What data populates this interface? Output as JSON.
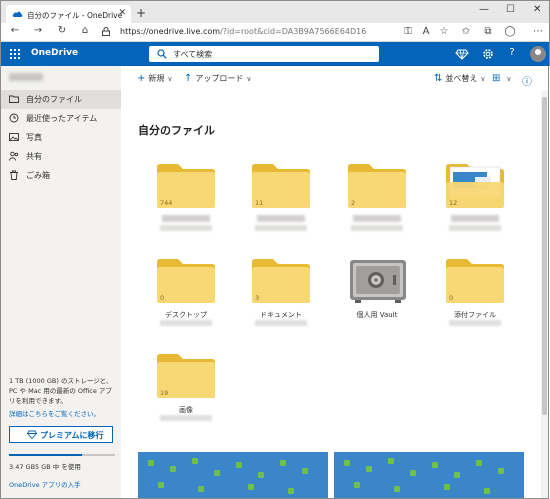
{
  "browser": {
    "tab_title": "自分のファイル - OneDrive",
    "tab_close": "✕",
    "new_tab": "+",
    "window_controls": {
      "minimize": "—",
      "maximize": "☐",
      "close": "✕"
    },
    "url_host": "https://onedrive.live.com",
    "url_query": "/?id=root&cid=DA3B9A7566E64D16",
    "nav": {
      "back": "←",
      "forward": "→",
      "refresh": "↻",
      "home": "⌂"
    }
  },
  "header": {
    "app_name": "OneDrive",
    "search_placeholder": "すべて検索",
    "help": "?"
  },
  "sidebar": {
    "items": [
      {
        "label": "自分のファイル",
        "icon": "folder-icon"
      },
      {
        "label": "最近使ったアイテム",
        "icon": "clock-icon"
      },
      {
        "label": "写真",
        "icon": "photo-icon"
      },
      {
        "label": "共有",
        "icon": "share-icon"
      },
      {
        "label": "ごみ箱",
        "icon": "trash-icon"
      }
    ],
    "storage_text": "1 TB (1000 GB) のストレージと、PC や Mac 用の最新の Office アプリを利用できます。",
    "detail_link": "詳細はこちらをご覧ください。",
    "premium_button": "プレミアムに移行",
    "usage_text": "3.47 GB5 GB 中 を使用",
    "get_app_link": "OneDrive アプリの入手",
    "storage_fraction": 0.69
  },
  "commands": {
    "new": "新規",
    "upload": "アップロード",
    "sort": "並べ替え"
  },
  "main": {
    "title": "自分のファイル",
    "folders": [
      {
        "count": "744",
        "name": ""
      },
      {
        "count": "11",
        "name": ""
      },
      {
        "count": "2",
        "name": ""
      },
      {
        "count": "12",
        "name": ""
      },
      {
        "count": "0",
        "name": "デスクトップ"
      },
      {
        "count": "3",
        "name": "ドキュメント"
      },
      {
        "count": "",
        "name": "個人用 Vault"
      },
      {
        "count": "0",
        "name": "添付ファイル"
      },
      {
        "count": "19",
        "name": "画像"
      }
    ]
  },
  "colors": {
    "brand": "#0364b8",
    "folder": "#f8d775",
    "folder_back": "#e8b934"
  }
}
